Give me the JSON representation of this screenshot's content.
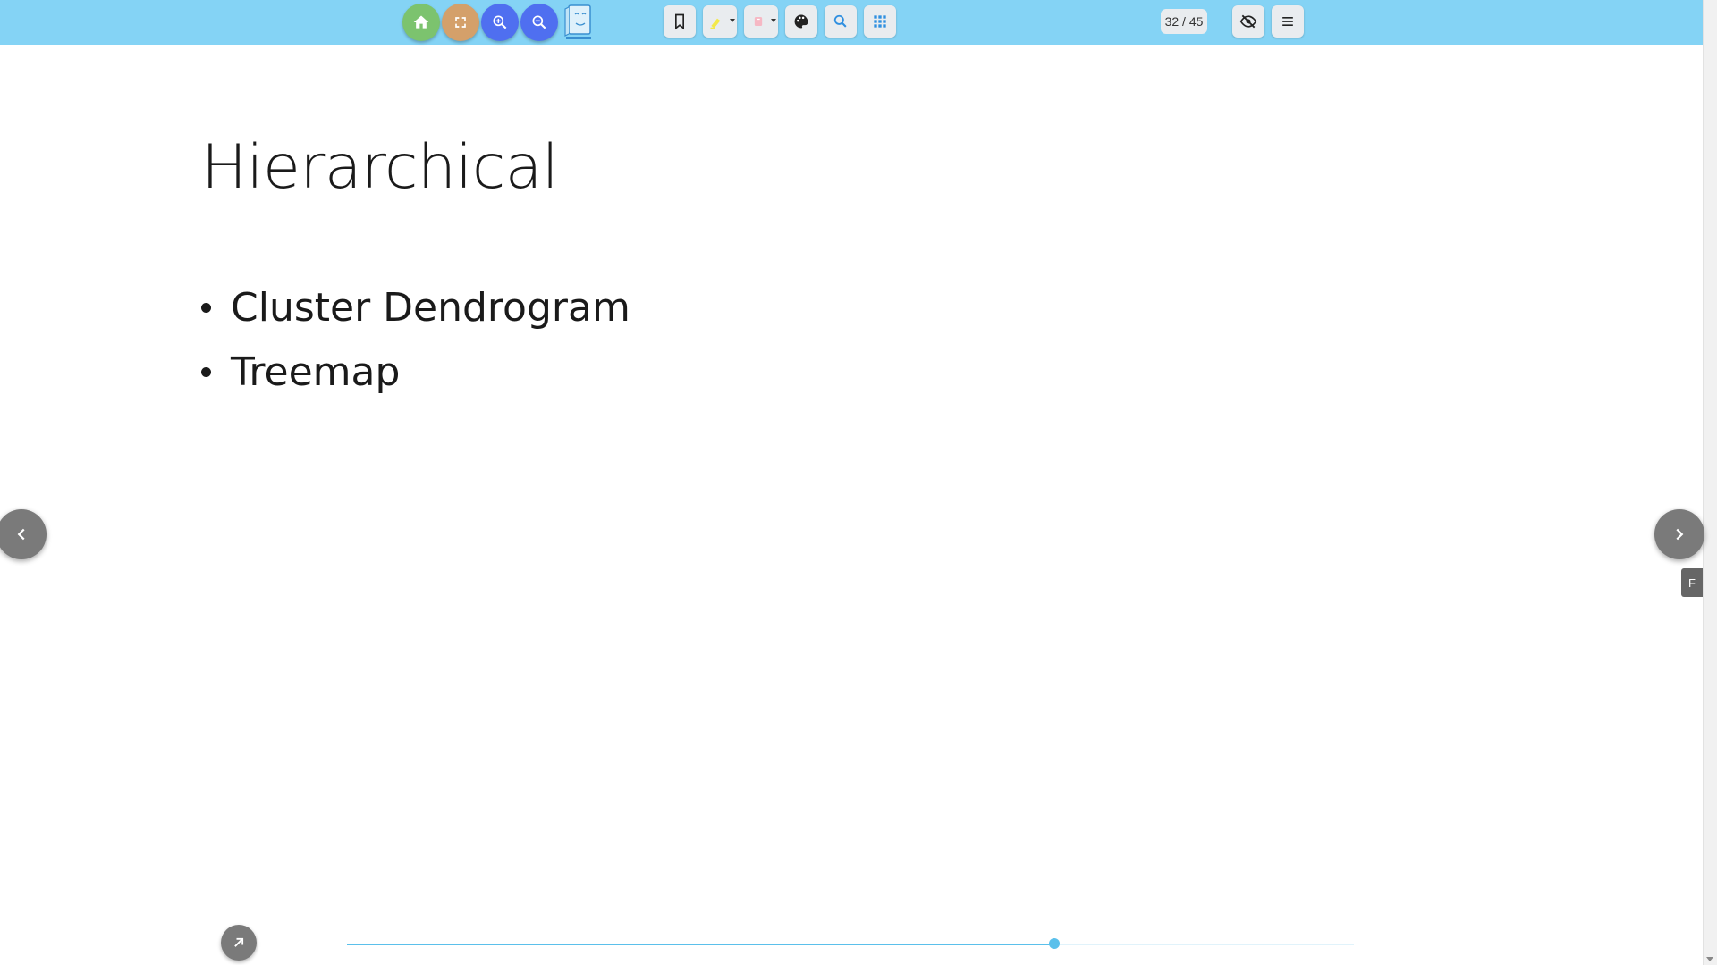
{
  "toolbar": {
    "background": "#84d3f5",
    "buttons": [
      {
        "name": "home-button",
        "icon": "home-icon",
        "color": "#7cc36e"
      },
      {
        "name": "fullscreen-button",
        "icon": "fullscreen-icon",
        "color": "#d4a06a"
      },
      {
        "name": "zoom-in-button",
        "icon": "zoom-in-icon",
        "color": "#4f6ff0"
      },
      {
        "name": "zoom-out-button",
        "icon": "zoom-out-icon",
        "color": "#4f6ff0"
      }
    ],
    "logo_icon": "book-face-logo-icon",
    "tools": [
      {
        "name": "bookmark-button",
        "icon": "bookmark-icon"
      },
      {
        "name": "highlighter-button",
        "icon": "highlighter-icon"
      },
      {
        "name": "eraser-button",
        "icon": "eraser-icon"
      },
      {
        "name": "palette-button",
        "icon": "palette-icon"
      },
      {
        "name": "search-button",
        "icon": "search-icon"
      },
      {
        "name": "thumbnails-button",
        "icon": "grid-icon"
      }
    ],
    "page_counter": "32 / 45",
    "hide_button_icon": "eye-off-icon",
    "menu_button_icon": "menu-icon"
  },
  "slide": {
    "title": "Hierarchical",
    "bullets": [
      "Cluster Dendrogram",
      "Treemap"
    ]
  },
  "navigation": {
    "prev_icon": "chevron-left-icon",
    "next_icon": "chevron-right-icon",
    "side_tab_label": "F"
  },
  "bottom": {
    "share_icon": "arrow-up-right-icon",
    "progress": 0.7024,
    "progress_color": "#5bc0eb"
  }
}
